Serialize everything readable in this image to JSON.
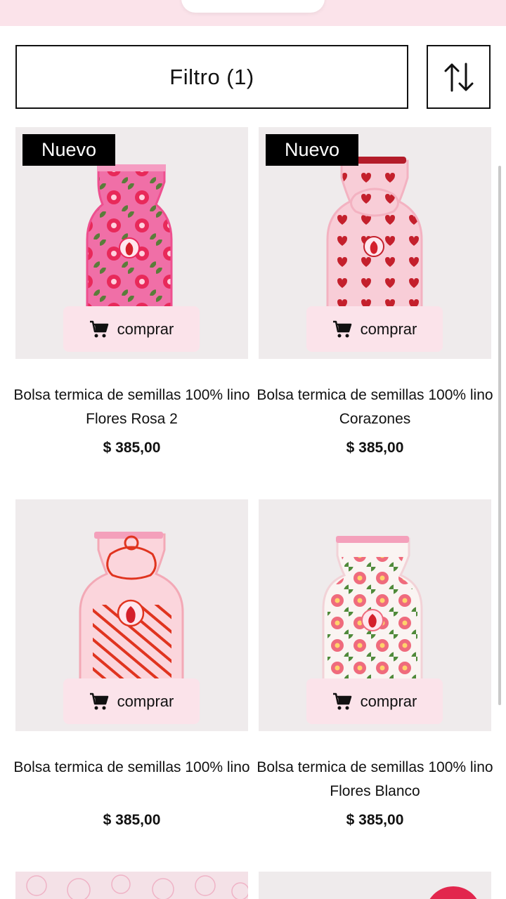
{
  "toolbar": {
    "filter_label": "Filtro (1)",
    "sort_icon": "sort-arrows-icon"
  },
  "products": [
    {
      "badge": "Nuevo",
      "buy_label": "comprar",
      "title": "Bolsa termica de semillas 100% lino Flores Rosa 2",
      "price": "$ 385,00",
      "colors": {
        "bag": "#f06fa7",
        "pattern": "#e8295a",
        "leaf": "#5a7d3a"
      }
    },
    {
      "badge": "Nuevo",
      "buy_label": "comprar",
      "title": "Bolsa termica de semillas 100% lino Corazones",
      "price": "$ 385,00",
      "colors": {
        "bag": "#f8cdd7",
        "pattern": "#c4202c",
        "leaf": "#c4202c"
      }
    },
    {
      "badge": "",
      "buy_label": "comprar",
      "title": "Bolsa termica de semillas 100% lino",
      "price": "$ 385,00",
      "colors": {
        "bag": "#fbd5dc",
        "pattern": "#e0341f",
        "leaf": "#e0341f"
      }
    },
    {
      "badge": "",
      "buy_label": "comprar",
      "title": "Bolsa termica de semillas 100% lino Flores Blanco",
      "price": "$ 385,00",
      "colors": {
        "bag": "#faf4f2",
        "pattern": "#ef6b7d",
        "leaf": "#4f8a3a"
      }
    }
  ],
  "icons": {
    "cart": "cart-icon"
  },
  "accent_colors": {
    "header_band": "#fbe3ea",
    "button_bg": "#fbe3ea",
    "badge_bg": "#000000"
  }
}
